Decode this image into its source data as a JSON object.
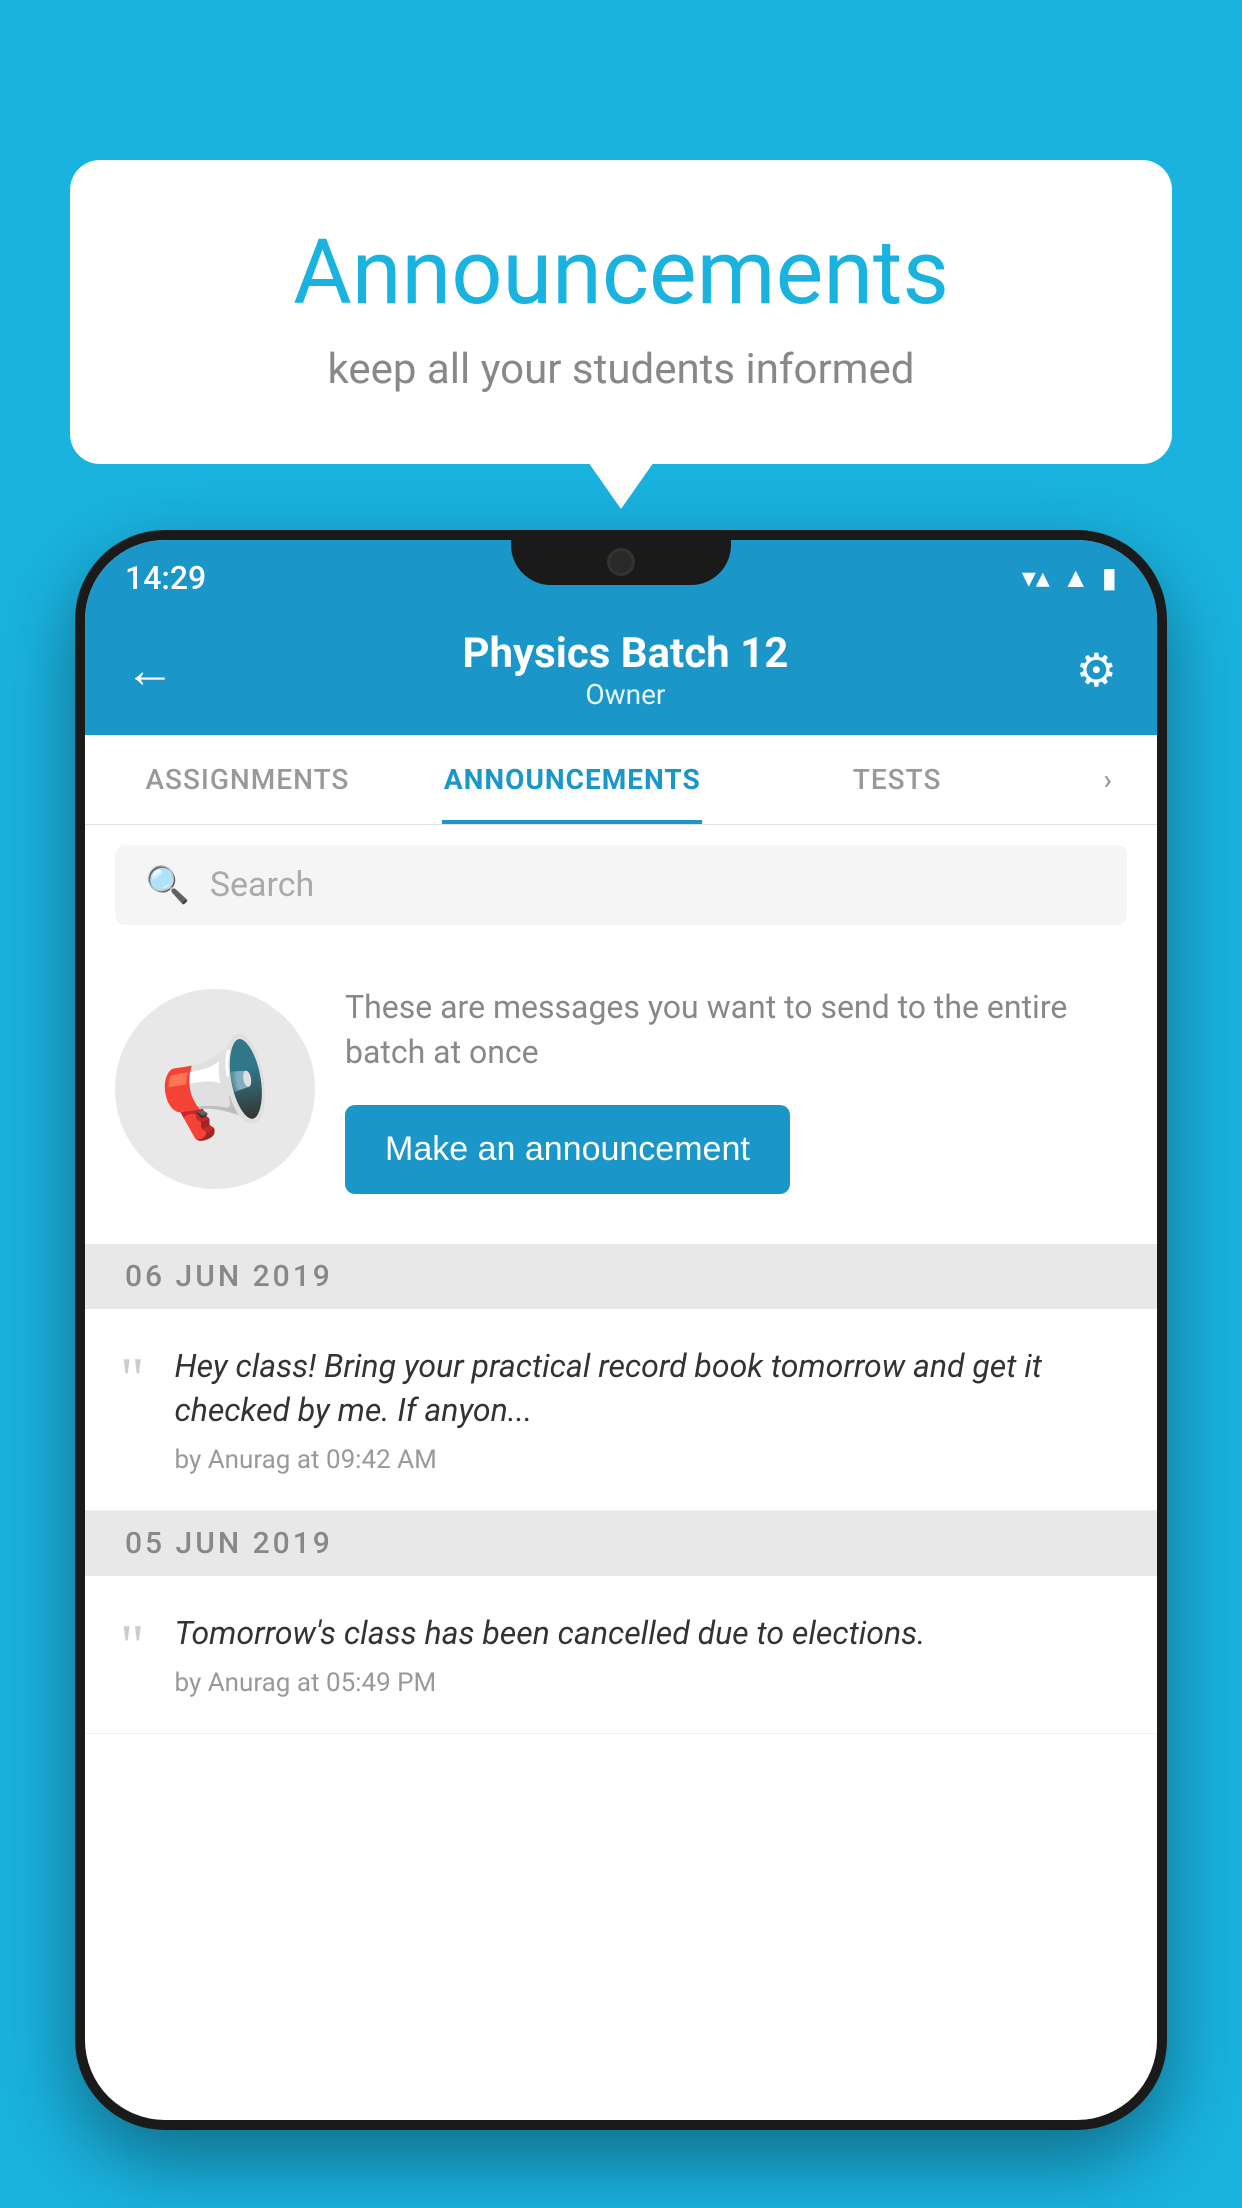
{
  "background_color": "#1ab3e0",
  "speech_bubble": {
    "title": "Announcements",
    "subtitle": "keep all your students informed"
  },
  "phone": {
    "status_bar": {
      "time": "14:29",
      "icons": [
        "wifi",
        "signal",
        "battery"
      ]
    },
    "app_bar": {
      "title": "Physics Batch 12",
      "subtitle": "Owner",
      "back_label": "←",
      "gear_label": "⚙"
    },
    "tabs": [
      {
        "label": "ASSIGNMENTS",
        "active": false
      },
      {
        "label": "ANNOUNCEMENTS",
        "active": true
      },
      {
        "label": "TESTS",
        "active": false
      }
    ],
    "search": {
      "placeholder": "Search"
    },
    "promo": {
      "description": "These are messages you want to send to the entire batch at once",
      "button_label": "Make an announcement"
    },
    "announcements": [
      {
        "date": "06  JUN  2019",
        "message": "Hey class! Bring your practical record book tomorrow and get it checked by me. If anyon...",
        "meta": "by Anurag at 09:42 AM"
      },
      {
        "date": "05  JUN  2019",
        "message": "Tomorrow's class has been cancelled due to elections.",
        "meta": "by Anurag at 05:49 PM"
      }
    ]
  }
}
